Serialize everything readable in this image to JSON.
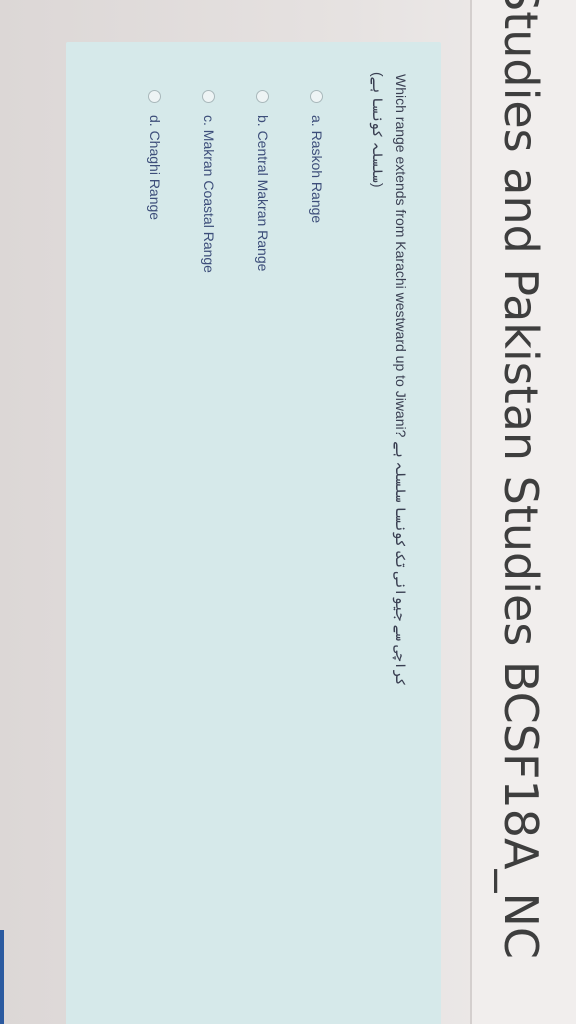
{
  "course": {
    "title": "Studies and Pakistan Studies BCSF18A_NC"
  },
  "question": {
    "text": "Which range extends from Karachi westward up to Jiwani? کراچی سے جیوانی تک کونسا سلسلہ ہے",
    "urdu_tail": "(سلسلہ کونسا ہے)"
  },
  "options": [
    {
      "label": "a. Raskoh Range",
      "selected": false
    },
    {
      "label": "b. Central Makran Range",
      "selected": false
    },
    {
      "label": "c. Makran Coastal Range",
      "selected": false
    },
    {
      "label": "d. Chaghi Range",
      "selected": false
    }
  ],
  "colors": {
    "card_background": "#d6e9ea",
    "option_text": "#3d4e7a",
    "title_text": "#3e3e3e"
  }
}
